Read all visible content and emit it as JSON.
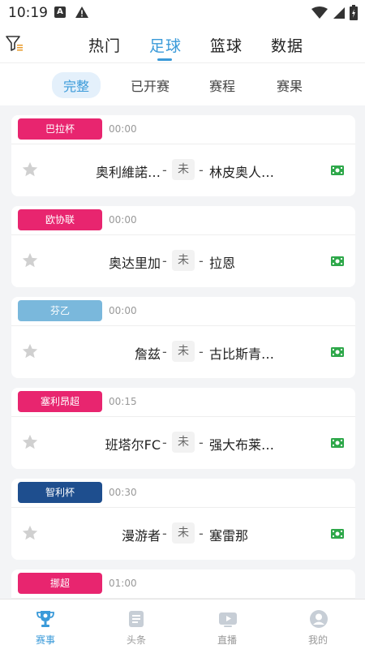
{
  "status_bar": {
    "time": "10:19",
    "notif_letter": "A"
  },
  "top_tabs": [
    {
      "label": "热门",
      "active": false
    },
    {
      "label": "足球",
      "active": true
    },
    {
      "label": "篮球",
      "active": false
    },
    {
      "label": "数据",
      "active": false
    }
  ],
  "sub_tabs": [
    {
      "label": "完整",
      "active": true
    },
    {
      "label": "已开赛",
      "active": false
    },
    {
      "label": "赛程",
      "active": false
    },
    {
      "label": "赛果",
      "active": false
    }
  ],
  "matches": [
    {
      "league": "巴拉杯",
      "league_color": "#e8256f",
      "time": "00:00",
      "home": "奥利維諾…",
      "status": "未",
      "away": "林皮奥人…"
    },
    {
      "league": "欧协联",
      "league_color": "#e8256f",
      "time": "00:00",
      "home": "奥达里加",
      "status": "未",
      "away": "拉恩"
    },
    {
      "league": "芬乙",
      "league_color": "#7ab8dc",
      "time": "00:00",
      "home": "詹兹",
      "status": "未",
      "away": "古比斯青…"
    },
    {
      "league": "塞利昂超",
      "league_color": "#e8256f",
      "time": "00:15",
      "home": "班塔尔FC",
      "status": "未",
      "away": "强大布莱…"
    },
    {
      "league": "智利杯",
      "league_color": "#1e4e8e",
      "time": "00:30",
      "home": "漫游者",
      "status": "未",
      "away": "塞雷那"
    },
    {
      "league": "挪超",
      "league_color": "#e8256f",
      "time": "01:00",
      "home": "",
      "status": "",
      "away": ""
    }
  ],
  "bottom_nav": [
    {
      "label": "赛事",
      "icon": "trophy-icon",
      "active": true
    },
    {
      "label": "头条",
      "icon": "news-icon",
      "active": false
    },
    {
      "label": "直播",
      "icon": "live-icon",
      "active": false
    },
    {
      "label": "我的",
      "icon": "profile-icon",
      "active": false
    }
  ],
  "colors": {
    "accent": "#3a9ad9",
    "video_green": "#2ea84a"
  }
}
